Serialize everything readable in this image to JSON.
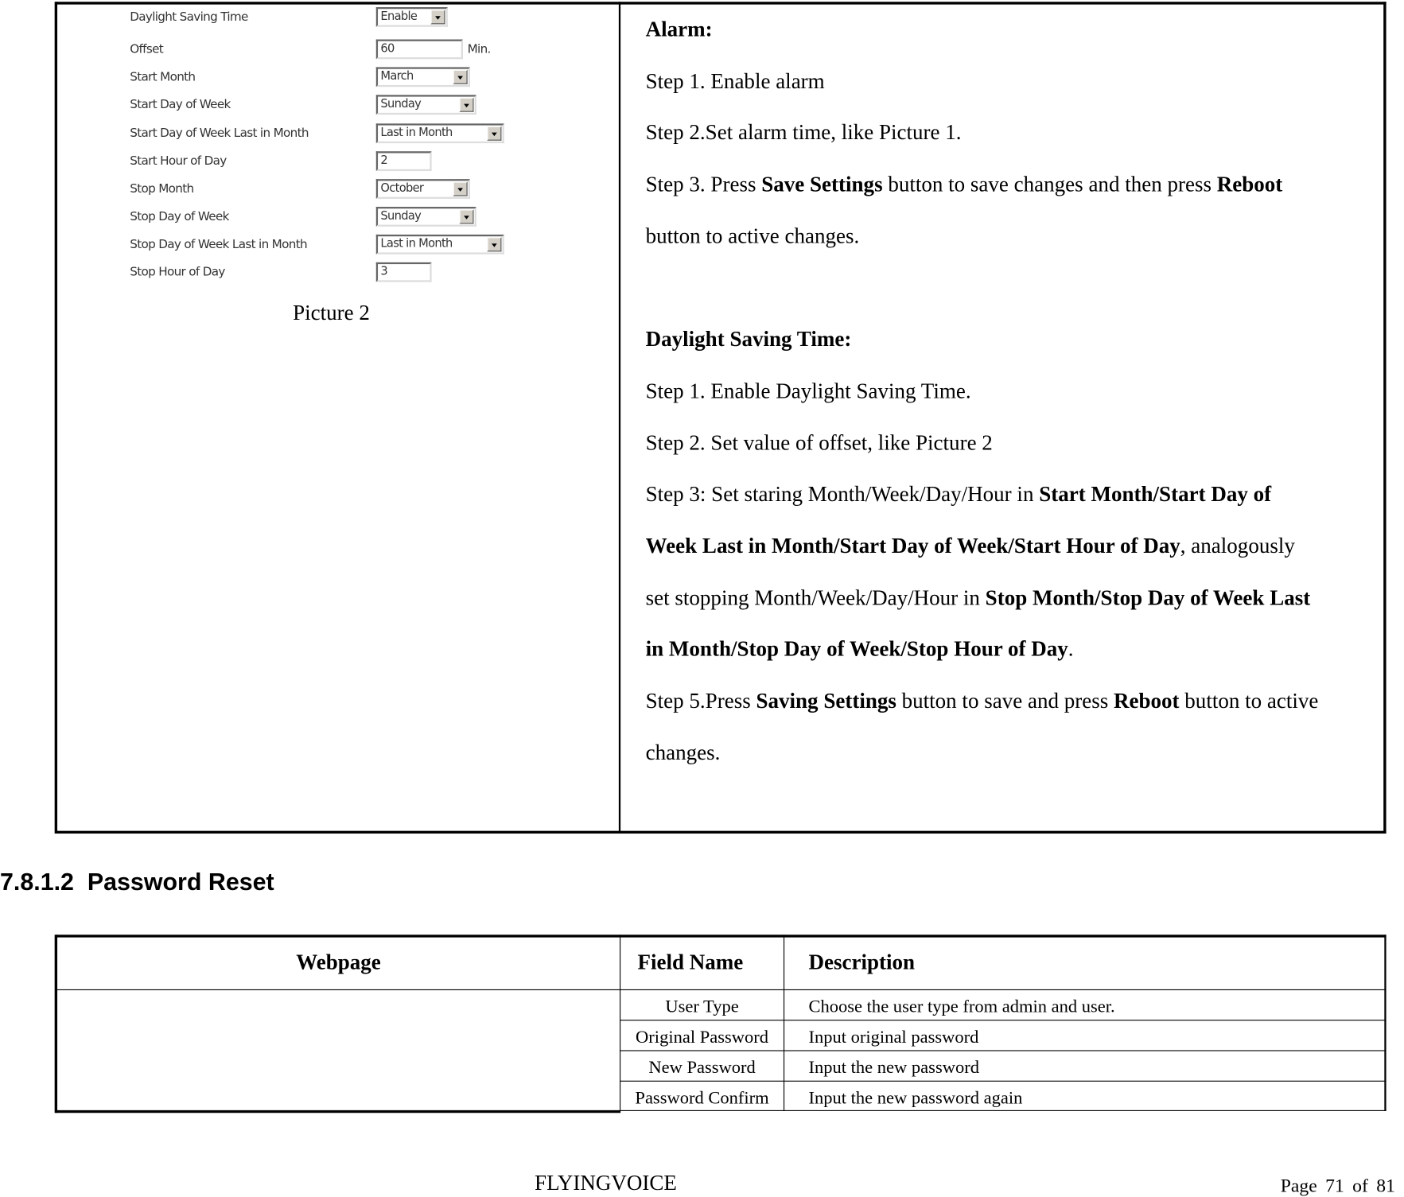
{
  "picture2": {
    "fields": [
      {
        "label": "Daylight Saving Time",
        "type": "select",
        "value": "Enable"
      },
      {
        "label": "Offset",
        "type": "input",
        "value": "60",
        "unit": "Min."
      },
      {
        "label": "Start Month",
        "type": "select",
        "value": "March"
      },
      {
        "label": "Start Day of Week",
        "type": "select",
        "value": "Sunday"
      },
      {
        "label": "Start Day of Week Last in Month",
        "type": "select",
        "value": "Last in Month"
      },
      {
        "label": "Start Hour of Day",
        "type": "input",
        "value": "2"
      },
      {
        "label": "Stop Month",
        "type": "select",
        "value": "October"
      },
      {
        "label": "Stop Day of Week",
        "type": "select",
        "value": "Sunday"
      },
      {
        "label": "Stop Day of Week Last in Month",
        "type": "select",
        "value": "Last in Month"
      },
      {
        "label": "Stop Hour of Day",
        "type": "input",
        "value": "3"
      }
    ],
    "caption": "Picture 2"
  },
  "instructions": [
    [
      {
        "t": "Alarm:",
        "b": true
      }
    ],
    [
      {
        "t": "Step 1. Enable alarm"
      }
    ],
    [
      {
        "t": "Step 2.Set alarm time, like Picture 1."
      }
    ],
    [
      {
        "t": "Step 3. Press "
      },
      {
        "t": "Save Settings",
        "b": true
      },
      {
        "t": " button to save changes and then press "
      },
      {
        "t": "Reboot",
        "b": true
      }
    ],
    [
      {
        "t": "button to active changes."
      }
    ],
    [],
    [
      {
        "t": "Daylight Saving Time:",
        "b": true
      }
    ],
    [
      {
        "t": "Step 1. Enable Daylight Saving Time."
      }
    ],
    [
      {
        "t": "Step 2. Set value of offset, like Picture 2"
      }
    ],
    [
      {
        "t": "Step 3: Set staring Month/Week/Day/Hour in "
      },
      {
        "t": "Start Month/Start Day of",
        "b": true
      }
    ],
    [
      {
        "t": "Week Last in Month/Start Day of Week/Start Hour of Day",
        "b": true
      },
      {
        "t": ", analogously"
      }
    ],
    [
      {
        "t": "set stopping Month/Week/Day/Hour in "
      },
      {
        "t": "Stop Month/Stop Day of Week Last",
        "b": true
      }
    ],
    [
      {
        "t": "in Month/Stop Day of Week/Stop Hour of Day",
        "b": true
      },
      {
        "t": "."
      }
    ],
    [
      {
        "t": "Step 5.Press "
      },
      {
        "t": "Saving Settings",
        "b": true
      },
      {
        "t": " button to save and press "
      },
      {
        "t": "Reboot",
        "b": true
      },
      {
        "t": " button to active"
      }
    ],
    [
      {
        "t": "changes."
      }
    ]
  ],
  "section_heading": "7.8.1.2  Password Reset",
  "password_table": {
    "headers": [
      "Webpage",
      "Field Name",
      "Description"
    ],
    "rows": [
      {
        "field": "User Type",
        "description": "Choose the user type from admin and user."
      },
      {
        "field": "Original Password",
        "description": "Input original password"
      },
      {
        "field": "New Password",
        "description": "Input the new password"
      },
      {
        "field": "Password Confirm",
        "description": "Input the new password again"
      }
    ]
  },
  "footer": {
    "brand": "FLYINGVOICE",
    "page_label": "Page",
    "page": "71",
    "of_label": "of",
    "total": "81"
  }
}
